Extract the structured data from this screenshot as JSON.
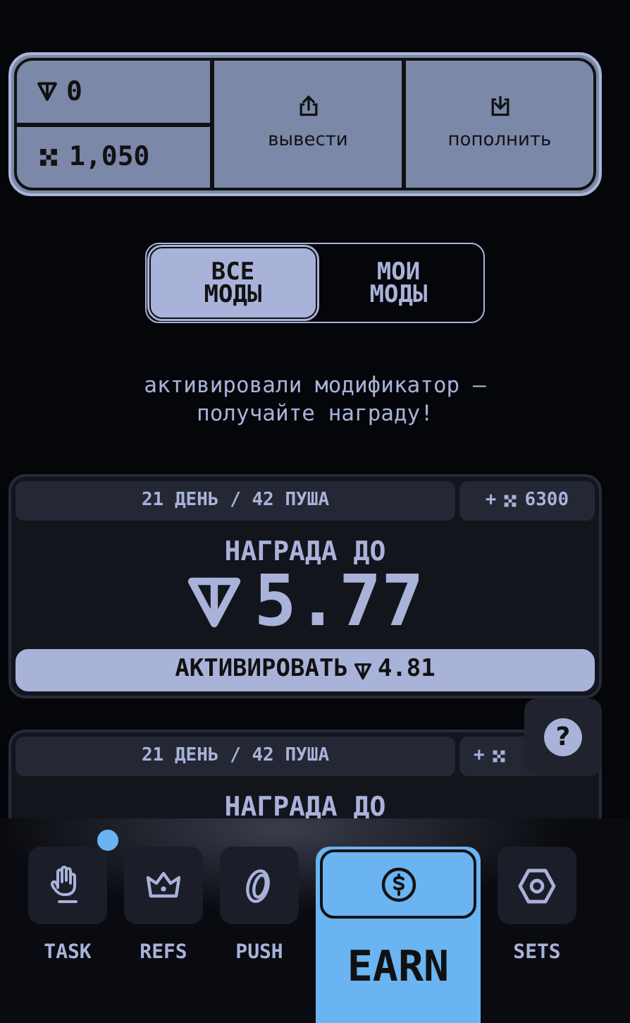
{
  "balance": {
    "ton": "0",
    "coins": "1,050"
  },
  "actions": [
    {
      "label": "вывести",
      "kind": "withdraw"
    },
    {
      "label": "пополнить",
      "kind": "deposit"
    }
  ],
  "mode_tabs": [
    {
      "label": "ВСЕ МОДЫ",
      "selected": true
    },
    {
      "label": "МОИ МОДЫ",
      "selected": false
    }
  ],
  "message": "активировали модификатор — получайте награду!",
  "cards": [
    {
      "duration": "21 ДЕНЬ / 42 ПУША",
      "bonus_sign": "+",
      "bonus": "6300",
      "reward_label": "НАГРАДА ДО",
      "reward": "5.77",
      "button": "АКТИВИРОВАТЬ",
      "price": "4.81"
    },
    {
      "duration": "21 ДЕНЬ / 42 ПУША",
      "bonus_sign": "+",
      "reward_label": "НАГРАДА ДО"
    }
  ],
  "help": "?",
  "nav": [
    {
      "label": "TASK",
      "kind": "hand",
      "selected": false,
      "badge": true
    },
    {
      "label": "REFS",
      "kind": "crown",
      "selected": false,
      "badge": false
    },
    {
      "label": "PUSH",
      "kind": "coin",
      "selected": false,
      "badge": false
    },
    {
      "label": "EARN",
      "kind": "dollar",
      "selected": true,
      "badge": false
    },
    {
      "label": "SETS",
      "kind": "nut",
      "selected": false,
      "badge": false
    }
  ]
}
